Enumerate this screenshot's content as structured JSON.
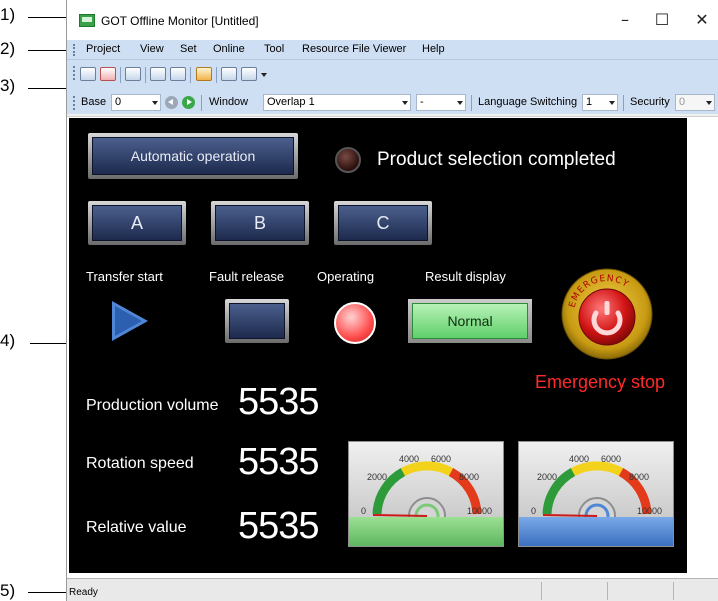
{
  "callouts": [
    "1)",
    "2)",
    "3)",
    "4)",
    "5)"
  ],
  "window": {
    "title": "GOT Offline Monitor [Untitled]",
    "controls": {
      "minimize": "–",
      "maximize": "☐",
      "close": "✕"
    }
  },
  "menu": [
    "Project",
    "View",
    "Set",
    "Online",
    "Tool",
    "Resource File Viewer",
    "Help"
  ],
  "toolbar": {
    "base_label": "Base",
    "base_value": "0",
    "window_label": "Window",
    "window_value": "Overlap 1",
    "dash_value": "-",
    "language_label": "Language Switching",
    "language_value": "1",
    "security_label": "Security",
    "security_value": "0"
  },
  "hmi": {
    "auto_button": "Automatic operation",
    "product_status": "Product selection completed",
    "buttons": [
      "A",
      "B",
      "C"
    ],
    "labels": {
      "transfer_start": "Transfer start",
      "fault_release": "Fault release",
      "operating": "Operating",
      "result_display": "Result display"
    },
    "result_value": "Normal",
    "emergency_ring_text": "EMERGENCY",
    "emergency_stop": "Emergency stop",
    "metrics": [
      {
        "label": "Production volume",
        "value": "5535"
      },
      {
        "label": "Rotation speed",
        "value": "5535"
      },
      {
        "label": "Relative value",
        "value": "5535"
      }
    ],
    "gauges": [
      {
        "ticks": [
          "0",
          "2000",
          "4000",
          "6000",
          "8000",
          "10000"
        ],
        "bar_color": "#7cc97a"
      },
      {
        "ticks": [
          "0",
          "2000",
          "4000",
          "6000",
          "8000",
          "10000"
        ],
        "bar_color": "#4f86d6"
      }
    ]
  },
  "status": {
    "text": "Ready"
  },
  "colors": {
    "hmi_background": "#000000",
    "menu_band": "#cfdff3",
    "emergency_text": "#ff2a2a"
  }
}
